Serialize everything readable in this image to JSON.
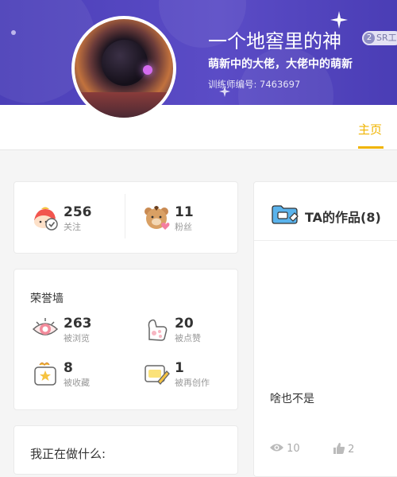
{
  "profile": {
    "username": "一个地窖里的神",
    "badge_number": "2",
    "badge_text": "SR工",
    "motto": "萌新中的大佬，大佬中的萌新",
    "trainer_id": "训练师编号: 7463697"
  },
  "tabs": {
    "home": "主页"
  },
  "stats": {
    "following": {
      "value": "256",
      "label": "关注"
    },
    "fans": {
      "value": "11",
      "label": "粉丝"
    }
  },
  "honor": {
    "title": "荣誉墙",
    "views": {
      "value": "263",
      "label": "被浏览"
    },
    "likes": {
      "value": "20",
      "label": "被点赞"
    },
    "favorites": {
      "value": "8",
      "label": "被收藏"
    },
    "remixes": {
      "value": "1",
      "label": "被再创作"
    }
  },
  "works": {
    "title": "TA的作品(8)",
    "first_item": {
      "description": "啥也不是",
      "views": "10",
      "likes": "2"
    }
  },
  "doing": {
    "title": "我正在做什么:"
  },
  "colors": {
    "accent": "#f0b400",
    "banner": "#4b3fb8"
  }
}
